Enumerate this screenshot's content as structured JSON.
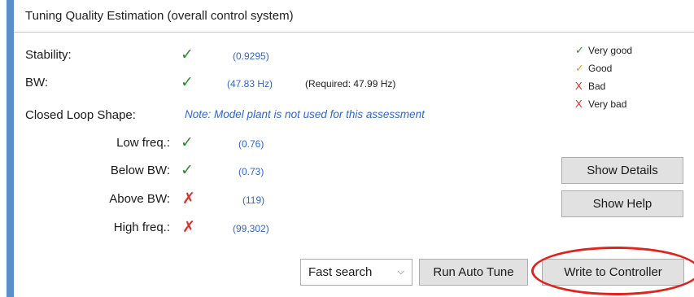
{
  "panel": {
    "title": "Tuning Quality Estimation (overall control system)"
  },
  "rows": {
    "stability": {
      "label": "Stability:",
      "status": "check-icon",
      "value": "(0.9295)"
    },
    "bw": {
      "label": "BW:",
      "status": "check-icon",
      "value": "(47.83 Hz)",
      "required": "(Required: 47.99 Hz)"
    },
    "closed_loop": {
      "label": "Closed Loop Shape:",
      "note": "Note: Model plant is not used for this assessment"
    },
    "low_freq": {
      "label": "Low freq.:",
      "status": "check-icon",
      "value": "(0.76)"
    },
    "below_bw": {
      "label": "Below BW:",
      "status": "check-icon",
      "value": "(0.73)"
    },
    "above_bw": {
      "label": "Above BW:",
      "status": "cross-icon",
      "value": "(119)"
    },
    "high_freq": {
      "label": "High freq.:",
      "status": "cross-icon",
      "value": "(99,302)"
    }
  },
  "legend": {
    "very_good": {
      "symbol": "✓",
      "label": "Very good"
    },
    "good": {
      "symbol": "✓",
      "label": "Good"
    },
    "bad": {
      "symbol": "X",
      "label": "Bad"
    },
    "very_bad": {
      "symbol": "X",
      "label": "Very bad"
    }
  },
  "buttons": {
    "show_details": "Show Details",
    "show_help": "Show Help",
    "run_auto_tune": "Run Auto Tune",
    "write_to_controller": "Write to Controller"
  },
  "search_mode": {
    "selected": "Fast search"
  },
  "colors": {
    "accent": "#5b8fc9",
    "good": "#2e8b2e",
    "good_orange": "#e59a2a",
    "bad": "#d9322c",
    "value_blue": "#2f66d0",
    "highlight": "#e0231c"
  }
}
